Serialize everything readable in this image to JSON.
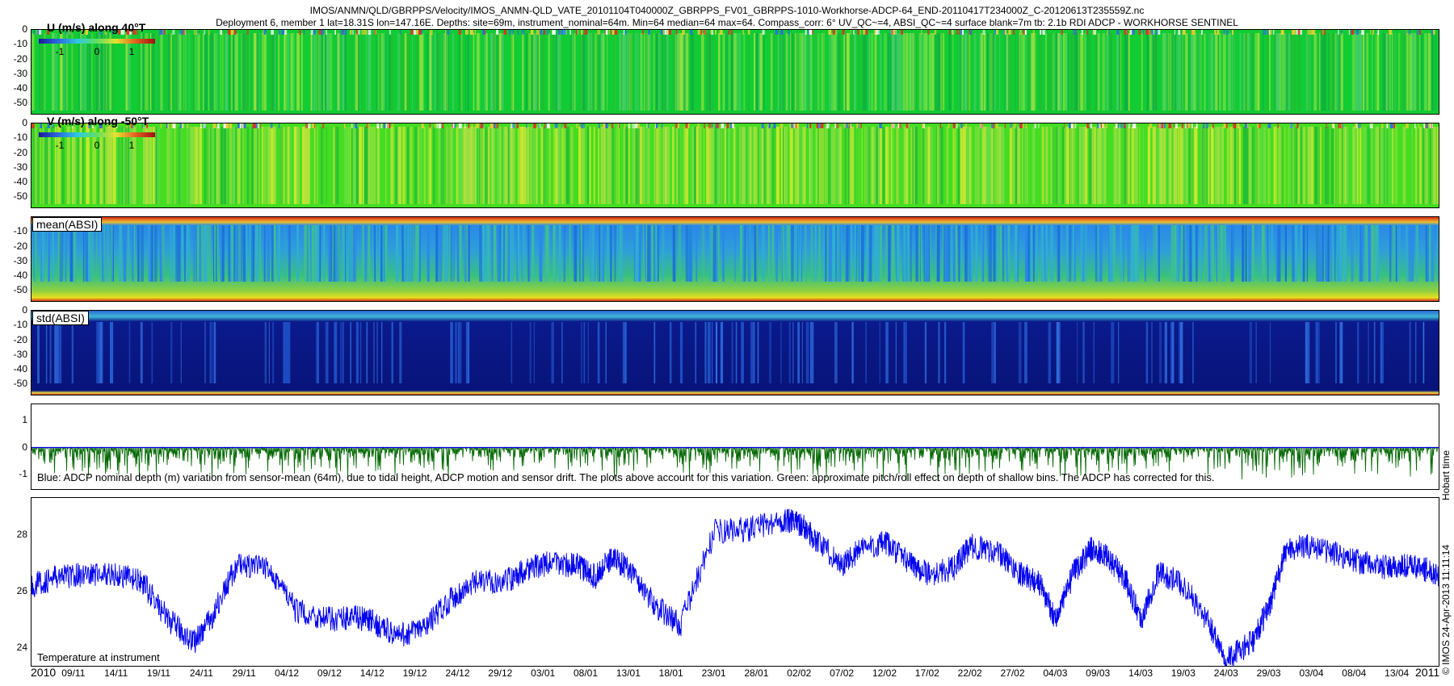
{
  "title_lines": [
    "IMOS/ANMN/QLD/GBRPPS/Velocity/IMOS_ANMN-QLD_VATE_20101104T040000Z_GBRPPS_FV01_GBRPPS-1010-Workhorse-ADCP-64_END-20110417T234000Z_C-20120613T235559Z.nc",
    "Deployment 6, member 1 lat=18.31S lon=147.16E. Depths: site=69m, instrument_nominal=64m. Min=64 median=64 max=64. Compass_corr: 6° UV_QC~=4, ABSI_QC~=4 surface blank=7m tb: 2.1b RDI ADCP - WORKHORSE SENTINEL"
  ],
  "panel_labels": {
    "u": "U (m/s) along 40°T",
    "v": "V (m/s) along -50°T",
    "absi_mean": "mean(ABSI)",
    "absi_std": "std(ABSI)",
    "temp": "Temperature at instrument"
  },
  "colorbar_ticks": [
    "-1",
    "0",
    "1"
  ],
  "depth_note": "Blue: ADCP nominal depth (m) variation from sensor-mean (64m), due to tidal height, ADCP motion and sensor drift. The plots above account for this variation. Green: approximate pitch/roll effect on depth of shallow bins. The ADCP has corrected for this.",
  "hobart_time": "Hobart time",
  "credit": "© IMOS 24-Apr-2013 11:11:14",
  "year_start": "2010",
  "year_end": "2011",
  "colors": {
    "blue": "#0000ee",
    "green": "#006600"
  },
  "chart_data": [
    {
      "type": "heatmap",
      "title": "U (m/s) along 40°T",
      "ylim": [
        -58,
        0
      ],
      "yticks": [
        "0",
        "-10",
        "-20",
        "-30",
        "-40",
        "-50"
      ],
      "colorbar": [
        -1,
        0,
        1
      ]
    },
    {
      "type": "heatmap",
      "title": "V (m/s) along -50°T",
      "ylim": [
        -58,
        0
      ],
      "yticks": [
        "0",
        "-10",
        "-20",
        "-30",
        "-40",
        "-50"
      ],
      "colorbar": [
        -1,
        0,
        1
      ]
    },
    {
      "type": "heatmap",
      "title": "mean(ABSI)",
      "ylim": [
        -58,
        0
      ],
      "yticks": [
        "-10",
        "-20",
        "-30",
        "-40",
        "-50"
      ]
    },
    {
      "type": "heatmap",
      "title": "std(ABSI)",
      "ylim": [
        -58,
        0
      ],
      "yticks": [
        "0",
        "-10",
        "-20",
        "-30",
        "-40",
        "-50"
      ]
    },
    {
      "type": "line",
      "ylim": [
        -1.6,
        1.6
      ],
      "yticks": [
        "1",
        "0",
        "-1"
      ],
      "series": [
        {
          "color": "#0000ee",
          "values": [
            0,
            0
          ]
        },
        {
          "color": "#006600",
          "min": -1.3,
          "max": 0
        }
      ]
    },
    {
      "type": "line",
      "title": "Temperature at instrument",
      "ylim": [
        23.3,
        29.3
      ],
      "yticks": [
        "28",
        "26",
        "24"
      ],
      "series": [
        {
          "color": "#0000ee",
          "x": [
            0,
            3,
            6,
            10,
            13,
            16,
            19,
            21,
            24,
            28,
            31,
            35,
            38,
            40,
            43,
            46,
            49,
            52,
            56,
            58,
            61,
            64,
            66,
            68,
            70,
            73,
            76,
            80,
            84,
            88,
            90,
            92,
            95,
            97,
            100,
            103,
            105,
            108,
            110,
            113,
            116,
            118,
            120,
            122,
            124,
            126,
            128,
            130,
            132,
            135,
            138,
            140,
            143,
            145,
            147,
            150,
            153,
            156,
            159,
            161,
            163,
            165
          ],
          "values": [
            26.2,
            26.5,
            26.6,
            26.6,
            26.3,
            25.0,
            24.2,
            25.0,
            26.9,
            26.8,
            25.3,
            25.0,
            25.1,
            24.9,
            24.4,
            24.7,
            25.7,
            26.3,
            26.4,
            26.8,
            27.0,
            26.9,
            26.5,
            27.2,
            26.8,
            25.5,
            24.8,
            28.1,
            28.2,
            28.5,
            28.4,
            27.8,
            26.9,
            27.5,
            27.7,
            27.0,
            26.6,
            26.8,
            27.6,
            27.4,
            26.6,
            26.3,
            25.0,
            26.6,
            27.5,
            27.2,
            26.5,
            25.0,
            26.7,
            26.2,
            24.8,
            23.6,
            24.2,
            25.5,
            27.5,
            27.6,
            27.3,
            27.0,
            26.8,
            26.9,
            26.8,
            26.6
          ]
        }
      ],
      "x_unit": "days since 04/11/2010"
    }
  ],
  "x_axis": {
    "ticks": [
      "09/11",
      "14/11",
      "19/11",
      "24/11",
      "29/11",
      "04/12",
      "09/12",
      "14/12",
      "19/12",
      "24/12",
      "29/12",
      "03/01",
      "08/01",
      "13/01",
      "18/01",
      "23/01",
      "28/01",
      "02/02",
      "07/02",
      "12/02",
      "17/02",
      "22/02",
      "27/02",
      "04/03",
      "09/03",
      "14/03",
      "19/03",
      "24/03",
      "29/03",
      "03/04",
      "08/04",
      "13/04"
    ]
  }
}
